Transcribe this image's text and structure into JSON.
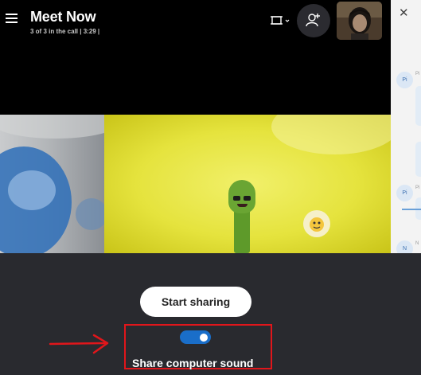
{
  "header": {
    "title": "Meet Now",
    "subtitle": "3 of 3 in the call | 3:29 |",
    "layout_icon": "layout-view-icon",
    "add_icon": "add-person-icon",
    "menu_icon": "hamburger-menu-icon"
  },
  "side_panel": {
    "close_icon": "close-icon",
    "avatars": [
      "Pi",
      "Pi",
      "N"
    ],
    "labels": [
      "Pi",
      "Pi",
      "N"
    ]
  },
  "share": {
    "button_label": "Start sharing",
    "toggle_label": "Share computer sound",
    "toggle_on": true
  },
  "colors": {
    "accent": "#1a6ec9",
    "highlight": "#e0161b",
    "bar_background": "#292a2f"
  }
}
